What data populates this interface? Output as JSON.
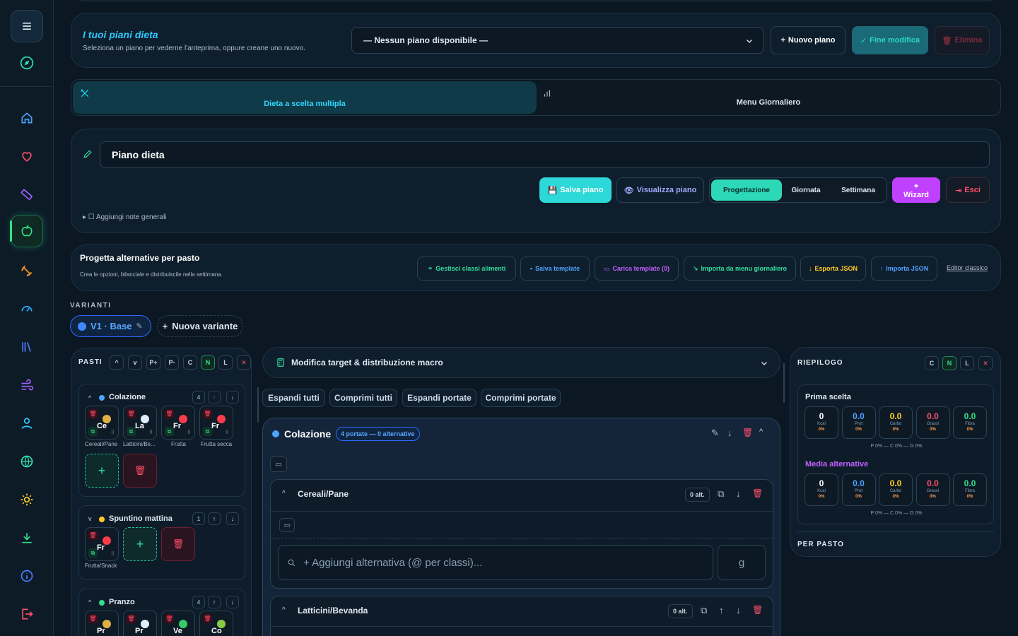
{
  "sidebar": {
    "items": [
      "menu-icon",
      "compass-icon",
      "home-icon",
      "heart-icon",
      "ruler-icon",
      "apple-icon",
      "dumbbell-icon",
      "gauge-icon",
      "library-icon",
      "wind-icon",
      "user-icon",
      "globe-icon",
      "sun-icon",
      "download-icon",
      "info-icon",
      "logout-icon"
    ]
  },
  "plans": {
    "title": "I tuoi piani dieta",
    "subtitle": "Seleziona un piano per vederne l'anteprima, oppure creane uno nuovo.",
    "select_value": "— Nessun piano disponibile —",
    "new_label": "Nuovo piano",
    "finish_label": "Fine modifica",
    "delete_label": "Elimina"
  },
  "tabs": {
    "multi": "Dieta a scelta multipla",
    "daily": "Menu Giornaliero"
  },
  "editor": {
    "name": "Piano dieta",
    "save": "Salva piano",
    "view": "Visualizza piano",
    "mode_design": "Progettazione",
    "mode_day": "Giornata",
    "mode_week": "Settimana",
    "wizard": "Wizard",
    "exit": "Esci",
    "notes": "▸ ☐ Aggiungi note generali"
  },
  "design": {
    "title": "Progetta alternative per pasto",
    "subtitle": "Crea le opzioni, bilanciale e distribuiscile nella settimana.",
    "manage": "Gestisci classi alimenti",
    "save_tpl": "Salva template",
    "load_tpl": "Carica template (0)",
    "import_menu": "Importa da menu giornaliero",
    "export_json": "Esporta JSON",
    "import_json": "Importa JSON",
    "classic": "Editor classico"
  },
  "variants": {
    "heading": "VARIANTI",
    "current": "V1 · Base",
    "new": "Nuova variante"
  },
  "meals": {
    "heading": "PASTI",
    "controls": [
      "P+",
      "P-",
      "C",
      "N",
      "L"
    ],
    "colazione": {
      "name": "Colazione",
      "count": "4",
      "color": "#4da3ff",
      "foods": [
        {
          "code": "Ce",
          "label": "Cereali/Pane",
          "color": "#e0b040"
        },
        {
          "code": "La",
          "label": "Latticini/Be...",
          "color": "#ddeeff"
        },
        {
          "code": "Fr",
          "label": "Frutta",
          "color": "#ff3a4a"
        },
        {
          "code": "Fr",
          "label": "Frutta secca",
          "color": "#ff3a4a"
        }
      ]
    },
    "spuntino": {
      "name": "Spuntino mattina",
      "count": "1",
      "color": "#ffcc22",
      "foods": [
        {
          "code": "Fr",
          "label": "Frutta/Snack",
          "color": "#ff3a4a"
        }
      ]
    },
    "pranzo": {
      "name": "Pranzo",
      "count": "4",
      "color": "#33dd88",
      "foods": [
        {
          "code": "Pr",
          "color": "#e0b040"
        },
        {
          "code": "Pr",
          "color": "#ddeeff"
        },
        {
          "code": "Ve",
          "color": "#33cc66"
        },
        {
          "code": "Co",
          "color": "#88cc44"
        }
      ]
    }
  },
  "center": {
    "target": "Modifica target & distribuzione macro",
    "expand_all": "Espandi tutti",
    "collapse_all": "Comprimi tutti",
    "expand_courses": "Espandi portate",
    "collapse_courses": "Comprimi portate",
    "meal": "Colazione",
    "meal_badge": "4 portate — 0 alternative",
    "course1": "Cereali/Pane",
    "course1_badge": "0 alt.",
    "search_placeholder": "+ Aggiungi alternativa (@ per classi)...",
    "unit": "g",
    "course2": "Latticini/Bevanda",
    "course2_badge": "0 alt."
  },
  "summary": {
    "heading": "RIEPILOGO",
    "controls": [
      "C",
      "N",
      "L"
    ],
    "first": "Prima scelta",
    "avg": "Media alternative",
    "per_meal": "PER PASTO",
    "footer": "P 0% — C 0% — G 0%",
    "macros": [
      {
        "value": "0",
        "label": "Kcal",
        "pct": "0%",
        "color": "#ffffff"
      },
      {
        "value": "0.0",
        "label": "Prot",
        "pct": "0%",
        "color": "#4da3ff"
      },
      {
        "value": "0.0",
        "label": "Carbo",
        "pct": "0%",
        "color": "#ffcc22"
      },
      {
        "value": "0.0",
        "label": "Grassi",
        "pct": "0%",
        "color": "#ff4f6a"
      },
      {
        "value": "0.0",
        "label": "Fibra",
        "pct": "0%",
        "color": "#33dd88"
      }
    ]
  }
}
